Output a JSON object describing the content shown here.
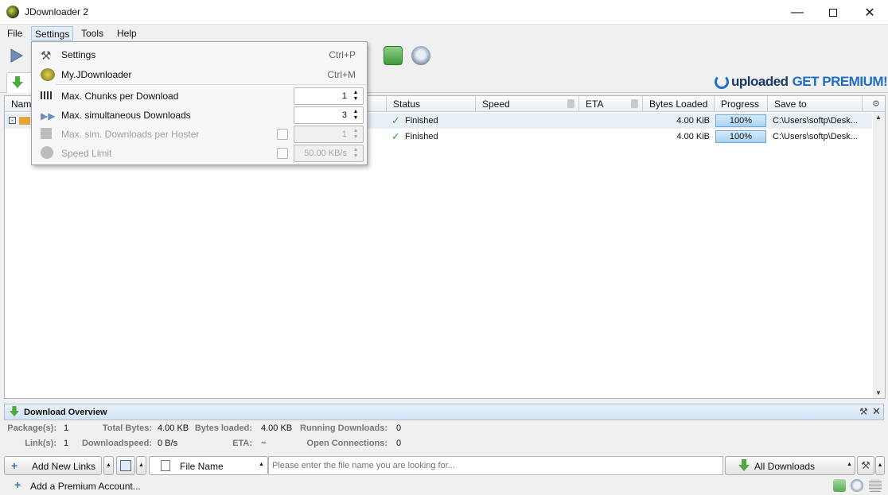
{
  "window": {
    "title": "JDownloader 2"
  },
  "menu": {
    "file": "File",
    "settings": "Settings",
    "tools": "Tools",
    "help": "Help"
  },
  "settings_menu": {
    "settings_label": "Settings",
    "settings_shortcut": "Ctrl+P",
    "myjd_label": "My.JDownloader",
    "myjd_shortcut": "Ctrl+M",
    "chunks_label": "Max. Chunks per Download",
    "chunks_value": "1",
    "simdl_label": "Max. simultaneous Downloads",
    "simdl_value": "3",
    "hoster_label": "Max. sim. Downloads per Hoster",
    "hoster_value": "1",
    "speed_label": "Speed Limit",
    "speed_value": "50.00 KB/s"
  },
  "ad": {
    "brand": "uploaded",
    "cta": "GET PREMIUM!"
  },
  "table": {
    "columns": {
      "name": "Nam",
      "status": "Status",
      "speed": "Speed",
      "eta": "ETA",
      "bytes_loaded": "Bytes Loaded",
      "progress": "Progress",
      "save_to": "Save to"
    },
    "rows": [
      {
        "status": "Finished",
        "bytes": "4.00 KiB",
        "progress": "100%",
        "save_to": "C:\\Users\\softp\\Desk..."
      },
      {
        "status": "Finished",
        "bytes": "4.00 KiB",
        "progress": "100%",
        "save_to": "C:\\Users\\softp\\Desk..."
      }
    ]
  },
  "overview": {
    "title": "Download Overview",
    "packages_label": "Package(s):",
    "packages_value": "1",
    "total_bytes_label": "Total Bytes:",
    "total_bytes_value": "4.00 KB",
    "bytes_loaded_label": "Bytes loaded:",
    "bytes_loaded_value": "4.00 KB",
    "running_label": "Running Downloads:",
    "running_value": "0",
    "links_label": "Link(s):",
    "links_value": "1",
    "speed_label": "Downloadspeed:",
    "speed_value": "0 B/s",
    "eta_label": "ETA:",
    "eta_value": "~",
    "connections_label": "Open Connections:",
    "connections_value": "0"
  },
  "bottom": {
    "add_links": "Add New Links",
    "search_field": "File Name",
    "search_placeholder": "Please enter the file name you are looking for...",
    "all_downloads": "All Downloads"
  },
  "status": {
    "add_premium": "Add a Premium Account..."
  },
  "colors": {
    "accent": "#1f6fc6",
    "progress_fill": "#a8d3f3",
    "finished_check": "#3aa43a"
  }
}
